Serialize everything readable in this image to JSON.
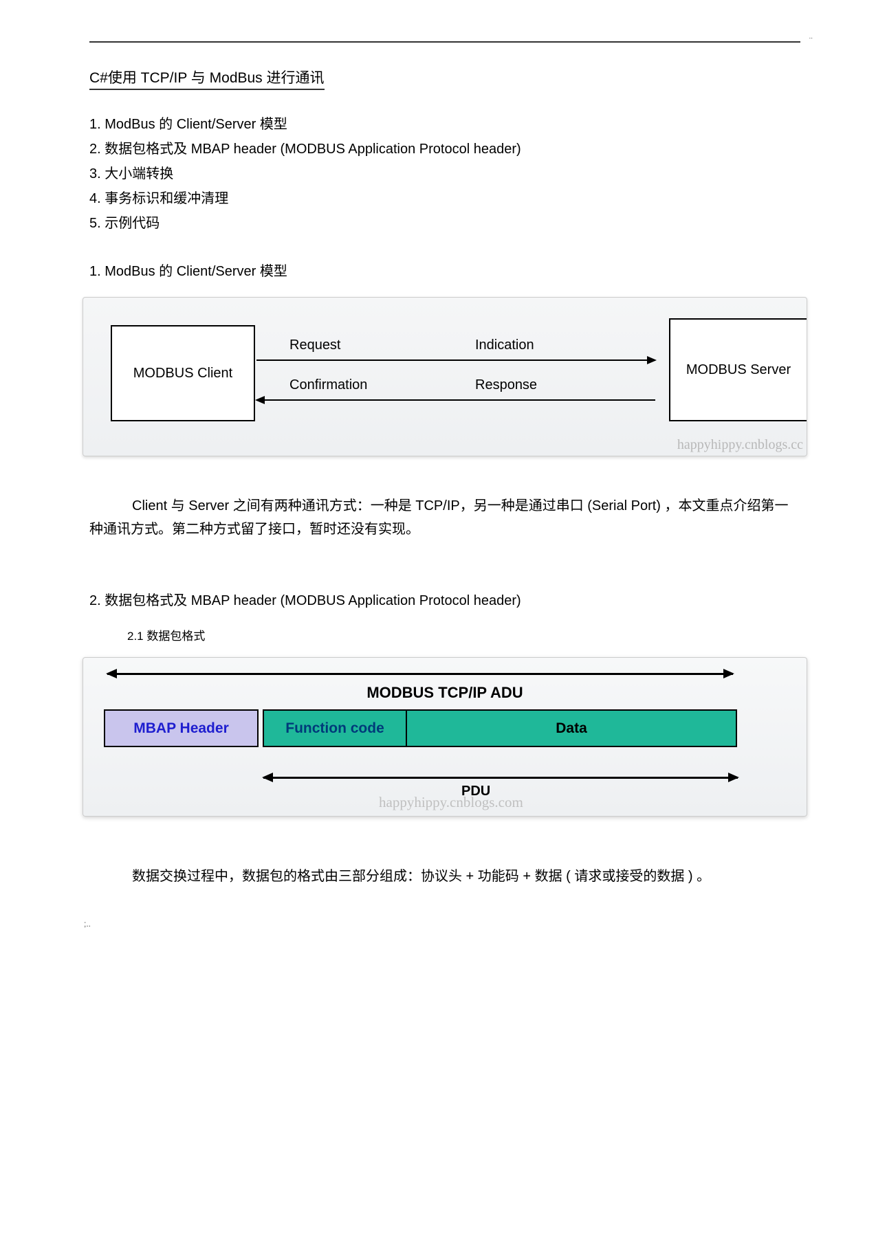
{
  "title": "C#使用 TCP/IP 与 ModBus 进行通讯",
  "toc": [
    "1. ModBus 的 Client/Server      模型",
    "2.  数据包格式及  MBAP header (MODBUS Application Protocol header)",
    "3.  大小端转换",
    "4.  事务标识和缓冲清理",
    "5.  示例代码"
  ],
  "section1": {
    "heading": "1. ModBus 的 Client/Server      模型",
    "diagram": {
      "client_label": "MODBUS Client",
      "server_label": "MODBUS Server",
      "request": "Request",
      "indication": "Indication",
      "confirmation": "Confirmation",
      "response": "Response",
      "watermark": "happyhippy.cnblogs.cc"
    },
    "paragraph": "Client 与 Server 之间有两种通讯方式：一种是 TCP/IP，另一种是通过串口 (Serial Port) ，本文重点介绍第一种通讯方式。第二种方式留了接口，暂时还没有实现。"
  },
  "section2": {
    "heading": "2.  数据包格式及  MBAP header (MODBUS Application Protocol header)",
    "sub_heading": "2.1   数据包格式",
    "diagram": {
      "adu_title": "MODBUS TCP/IP ADU",
      "mbap": "MBAP Header",
      "function": "Function code",
      "data": "Data",
      "pdu": "PDU",
      "watermark": "happyhippy.cnblogs.com"
    },
    "paragraph": "数据交换过程中，数据包的格式由三部分组成：协议头      + 功能码 + 数据 ( 请求或接受的数据 ) 。"
  },
  "footer_dots": ";.."
}
